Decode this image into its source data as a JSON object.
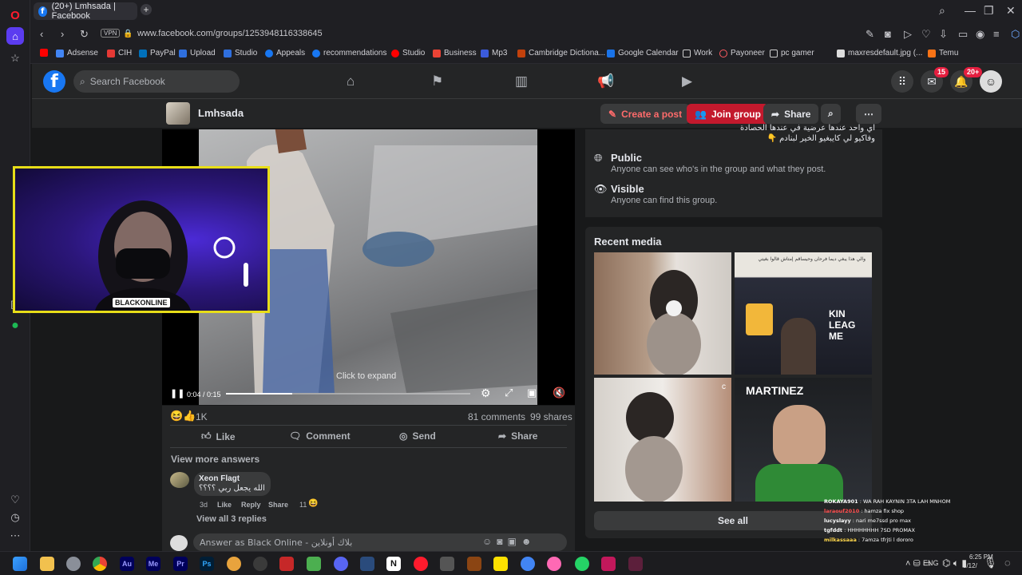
{
  "browser": {
    "tab_title": "(20+) Lmhsada | Facebook",
    "new_tab": "+",
    "url": "www.facebook.com/groups/1253948116338645",
    "vpn_label": "VPN",
    "bookmarks": [
      "Adsense",
      "CIH",
      "PayPal",
      "Upload",
      "Studio",
      "Appeals",
      "recommendations",
      "Studio",
      "Business",
      "Mp3",
      "Cambridge Dictiona...",
      "Google Calendar",
      "Work",
      "Payoneer",
      "pc gamer",
      "maxresdefault.jpg (...",
      "Temu"
    ]
  },
  "fb": {
    "search_placeholder": "Search Facebook",
    "messenger_badge": "15",
    "notifications_badge": "20+",
    "group_name": "Lmhsada",
    "create_post": "Create a post",
    "join_group": "Join group",
    "share": "Share"
  },
  "video": {
    "time": "0:04 / 0:15",
    "progress_fraction": 0.27,
    "click_to_expand": "Click to expand"
  },
  "post": {
    "reaction_count": "1K",
    "comments": "81 comments",
    "shares": "99 shares",
    "like": "Like",
    "comment": "Comment",
    "send": "Send",
    "share": "Share",
    "view_more": "View more answers",
    "comment_author": "Xeon Flagt",
    "comment_text": "الله يجعل ربي ؟؟؟؟",
    "comment_age": "3d",
    "comment_like": "Like",
    "comment_reply": "Reply",
    "comment_share": "Share",
    "comment_reacts": "11",
    "view_replies": "View all 3 replies",
    "answer_placeholder": "Answer as Black Online - بلاك أونلاين"
  },
  "about": {
    "arabic_line1": "اي واحد عندها عرضية في عندها الحصادة",
    "arabic_line2": "وفاكيو لي كايبغيو الخير لبنادم 👇",
    "public_title": "Public",
    "public_desc": "Anyone can see who's in the group and what they post.",
    "visible_title": "Visible",
    "visible_desc": "Anyone can find this group."
  },
  "media": {
    "title": "Recent media",
    "see_all": "See all",
    "thumb_caption_top": "والي هذا يبغي ديما فرحان وحيساقم إمتاش قالوا بغيتي",
    "thumb_kings": "KIN LEAG ME",
    "thumb_martinez": "MARTINEZ"
  },
  "stream": {
    "webcam_label": "BLACKONLINE",
    "chat": [
      {
        "user": "ROKAYA901",
        "msg": "WA RAH KAYNIN 3TA LAH MNHOM",
        "color": "#ffffff"
      },
      {
        "user": "laraouf2010",
        "msg": "hamza fix shop",
        "color": "#ff4d4d"
      },
      {
        "user": "lucyslayy",
        "msg": "nari me7ssd pro max",
        "color": "#ffffff"
      },
      {
        "user": "tgfddt",
        "msg": "HHHHHHHH 7SD PROMAX",
        "color": "#ffffff"
      },
      {
        "user": "milkassaaa",
        "msg": "7amza tfrjti l dororo",
        "color": "#ffd84d"
      }
    ]
  },
  "taskbar": {
    "lang": "ENG",
    "time": "6:25 PM",
    "date": "8/12/"
  }
}
